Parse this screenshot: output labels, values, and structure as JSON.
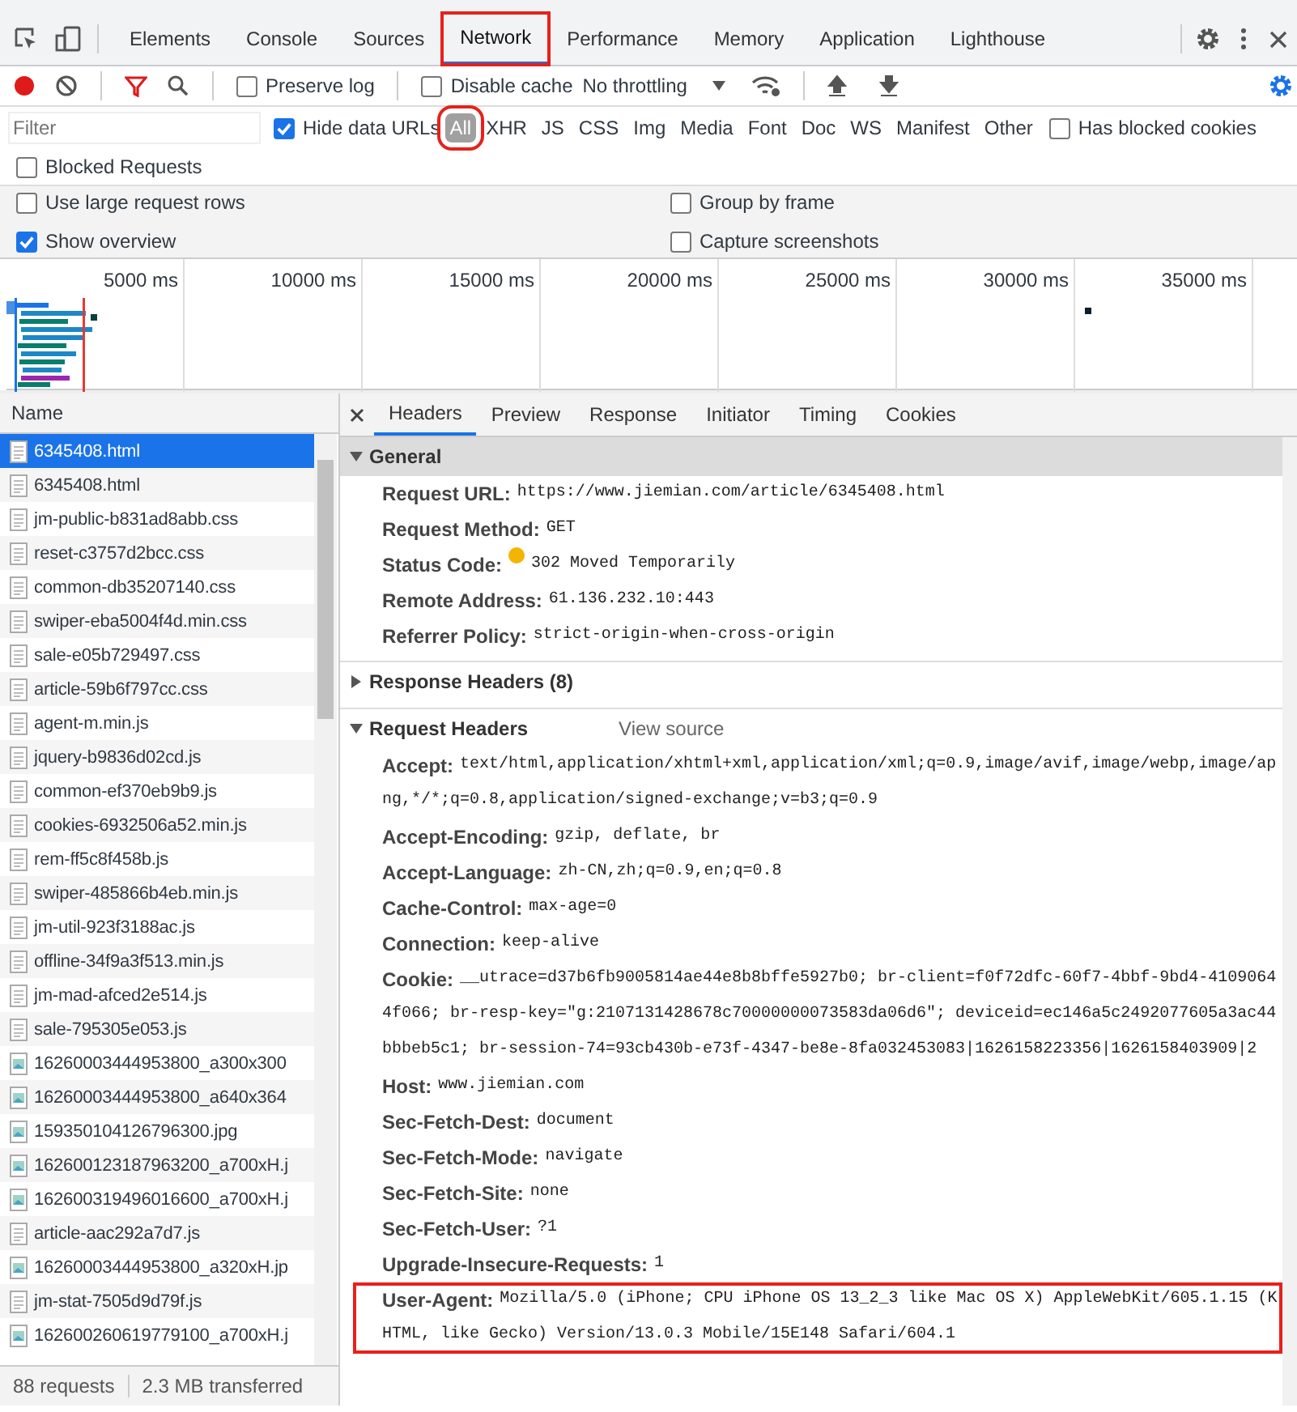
{
  "panel_tabs": [
    {
      "label": "Elements",
      "selected": false,
      "highlighted": false
    },
    {
      "label": "Console",
      "selected": false,
      "highlighted": false
    },
    {
      "label": "Sources",
      "selected": false,
      "highlighted": false
    },
    {
      "label": "Network",
      "selected": true,
      "highlighted": true
    },
    {
      "label": "Performance",
      "selected": false,
      "highlighted": false
    },
    {
      "label": "Memory",
      "selected": false,
      "highlighted": false
    },
    {
      "label": "Application",
      "selected": false,
      "highlighted": false
    },
    {
      "label": "Lighthouse",
      "selected": false,
      "highlighted": false
    }
  ],
  "toolbar": {
    "recording": true,
    "filter_active": true,
    "checkboxes": [
      {
        "label": "Preserve log",
        "checked": false
      },
      {
        "label": "Disable cache",
        "checked": false
      }
    ],
    "throttling": "No throttling"
  },
  "filter_bar": {
    "placeholder": "Filter",
    "hide_data_urls": {
      "label": "Hide data URLs",
      "checked": true
    },
    "types": [
      {
        "label": "All",
        "selected": true,
        "highlighted": true
      },
      {
        "label": "XHR",
        "selected": false
      },
      {
        "label": "JS",
        "selected": false
      },
      {
        "label": "CSS",
        "selected": false
      },
      {
        "label": "Img",
        "selected": false
      },
      {
        "label": "Media",
        "selected": false
      },
      {
        "label": "Font",
        "selected": false
      },
      {
        "label": "Doc",
        "selected": false
      },
      {
        "label": "WS",
        "selected": false
      },
      {
        "label": "Manifest",
        "selected": false
      },
      {
        "label": "Other",
        "selected": false
      }
    ],
    "has_blocked_cookies": {
      "label": "Has blocked cookies",
      "checked": false
    },
    "blocked_requests": {
      "label": "Blocked Requests",
      "checked": false
    }
  },
  "settings": [
    {
      "label": "Use large request rows",
      "checked": false
    },
    {
      "label": "Group by frame",
      "checked": false
    },
    {
      "label": "Show overview",
      "checked": true
    },
    {
      "label": "Capture screenshots",
      "checked": false
    }
  ],
  "overview": {
    "ticks": [
      "5000 ms",
      "10000 ms",
      "15000 ms",
      "20000 ms",
      "25000 ms",
      "30000 ms",
      "35000 ms"
    ]
  },
  "requests": {
    "column": "Name",
    "rows": [
      {
        "name": "6345408.html",
        "kind": "document",
        "selected": true
      },
      {
        "name": "6345408.html",
        "kind": "document",
        "selected": false
      },
      {
        "name": "jm-public-b831ad8abb.css",
        "kind": "document",
        "selected": false
      },
      {
        "name": "reset-c3757d2bcc.css",
        "kind": "document",
        "selected": false
      },
      {
        "name": "common-db35207140.css",
        "kind": "document",
        "selected": false
      },
      {
        "name": "swiper-eba5004f4d.min.css",
        "kind": "document",
        "selected": false
      },
      {
        "name": "sale-e05b729497.css",
        "kind": "document",
        "selected": false
      },
      {
        "name": "article-59b6f797cc.css",
        "kind": "document",
        "selected": false
      },
      {
        "name": "agent-m.min.js",
        "kind": "document",
        "selected": false
      },
      {
        "name": "jquery-b9836d02cd.js",
        "kind": "document",
        "selected": false
      },
      {
        "name": "common-ef370eb9b9.js",
        "kind": "document",
        "selected": false
      },
      {
        "name": "cookies-6932506a52.min.js",
        "kind": "document",
        "selected": false
      },
      {
        "name": "rem-ff5c8f458b.js",
        "kind": "document",
        "selected": false
      },
      {
        "name": "swiper-485866b4eb.min.js",
        "kind": "document",
        "selected": false
      },
      {
        "name": "jm-util-923f3188ac.js",
        "kind": "document",
        "selected": false
      },
      {
        "name": "offline-34f9a3f513.min.js",
        "kind": "document",
        "selected": false
      },
      {
        "name": "jm-mad-afced2e514.js",
        "kind": "document",
        "selected": false
      },
      {
        "name": "sale-795305e053.js",
        "kind": "document",
        "selected": false
      },
      {
        "name": "16260003444953800_a300x300",
        "kind": "image",
        "selected": false
      },
      {
        "name": "16260003444953800_a640x364",
        "kind": "image",
        "selected": false
      },
      {
        "name": "159350104126796300.jpg",
        "kind": "image",
        "selected": false
      },
      {
        "name": "162600123187963200_a700xH.j",
        "kind": "image",
        "selected": false
      },
      {
        "name": "162600319496016600_a700xH.j",
        "kind": "image",
        "selected": false
      },
      {
        "name": "article-aac292a7d7.js",
        "kind": "document",
        "selected": false
      },
      {
        "name": "16260003444953800_a320xH.jp",
        "kind": "image",
        "selected": false
      },
      {
        "name": "jm-stat-7505d9d79f.js",
        "kind": "document",
        "selected": false
      },
      {
        "name": "162600260619779100_a700xH.j",
        "kind": "image",
        "selected": false
      }
    ],
    "summary": [
      "88 requests",
      "2.3 MB transferred"
    ]
  },
  "detail_tabs": [
    {
      "label": "Headers",
      "selected": true
    },
    {
      "label": "Preview",
      "selected": false
    },
    {
      "label": "Response",
      "selected": false
    },
    {
      "label": "Initiator",
      "selected": false
    },
    {
      "label": "Timing",
      "selected": false
    },
    {
      "label": "Cookies",
      "selected": false
    }
  ],
  "sections": [
    {
      "title": "General",
      "expanded": true,
      "shaded": true,
      "headers": [
        {
          "name": "Request URL:",
          "value": "https://www.jiemian.com/article/6345408.html",
          "highlighted": false
        },
        {
          "name": "Request Method:",
          "value": "GET",
          "highlighted": false
        },
        {
          "name": "Status Code:",
          "value": "302 Moved Temporarily",
          "color": "#f4b400",
          "highlighted": false
        },
        {
          "name": "Remote Address:",
          "value": "61.136.232.10:443",
          "highlighted": false
        },
        {
          "name": "Referrer Policy:",
          "value": "strict-origin-when-cross-origin",
          "highlighted": false
        }
      ]
    },
    {
      "title": "Response Headers (8)",
      "expanded": false,
      "shaded": false
    },
    {
      "title": "Request Headers",
      "expanded": true,
      "shaded": false,
      "link": "View source",
      "headers": [
        {
          "name": "Accept:",
          "value": "text/html,application/xhtml+xml,application/xml;q=0.9,image/avif,image/webp,image/apng,*/*;q=0.8,application/signed-exchange;v=b3;q=0.9",
          "highlighted": false
        },
        {
          "name": "Accept-Encoding:",
          "value": "gzip, deflate, br",
          "highlighted": false
        },
        {
          "name": "Accept-Language:",
          "value": "zh-CN,zh;q=0.9,en;q=0.8",
          "highlighted": false
        },
        {
          "name": "Cache-Control:",
          "value": "max-age=0",
          "highlighted": false
        },
        {
          "name": "Connection:",
          "value": "keep-alive",
          "highlighted": false
        },
        {
          "name": "Cookie:",
          "value": "__utrace=d37b6fb9005814ae44e8b8bffe5927b0; br-client=f0f72dfc-60f7-4bbf-9bd4-41090644f066; br-resp-key=\"g:2107131428678c70000000073583da06d6\"; deviceid=ec146a5c2492077605a3ac44bbbeb5c1; br-session-74=93cb430b-e73f-4347-be8e-8fa032453083|1626158223356|1626158403909|2",
          "highlighted": false
        },
        {
          "name": "Host:",
          "value": "www.jiemian.com",
          "highlighted": false
        },
        {
          "name": "Sec-Fetch-Dest:",
          "value": "document",
          "highlighted": false
        },
        {
          "name": "Sec-Fetch-Mode:",
          "value": "navigate",
          "highlighted": false
        },
        {
          "name": "Sec-Fetch-Site:",
          "value": "none",
          "highlighted": false
        },
        {
          "name": "Sec-Fetch-User:",
          "value": "?1",
          "highlighted": false
        },
        {
          "name": "Upgrade-Insecure-Requests:",
          "value": "1",
          "highlighted": false
        },
        {
          "name": "User-Agent:",
          "value": "Mozilla/5.0 (iPhone; CPU iPhone OS 13_2_3 like Mac OS X) AppleWebKit/605.1.15 (KHTML, like Gecko) Version/13.0.3 Mobile/15E148 Safari/604.1",
          "highlighted": true
        }
      ]
    }
  ]
}
